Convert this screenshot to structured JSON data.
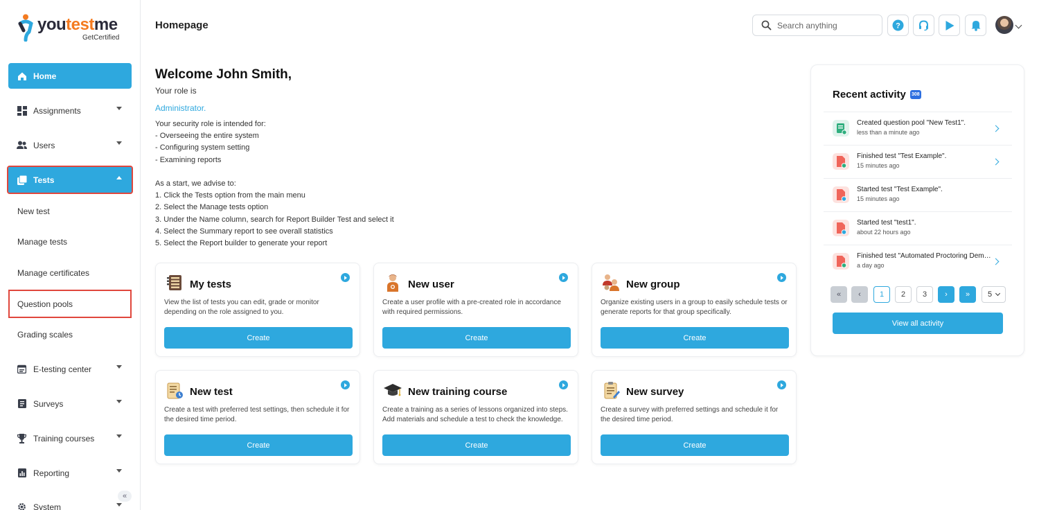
{
  "app": {
    "logo_text_1": "you",
    "logo_text_2": "test",
    "logo_text_3": "me",
    "logo_sub": "GetCertified"
  },
  "sidebar": {
    "items": [
      {
        "label": "Home",
        "icon": "home-icon"
      },
      {
        "label": "Assignments",
        "icon": "dashboard-icon"
      },
      {
        "label": "Users",
        "icon": "users-icon"
      },
      {
        "label": "Tests",
        "icon": "tests-icon"
      },
      {
        "label": "New test"
      },
      {
        "label": "Manage tests"
      },
      {
        "label": "Manage certificates"
      },
      {
        "label": "Question pools"
      },
      {
        "label": "Grading scales"
      },
      {
        "label": "E-testing center",
        "icon": "calendar-icon"
      },
      {
        "label": "Surveys",
        "icon": "survey-icon"
      },
      {
        "label": "Training courses",
        "icon": "trophy-icon"
      },
      {
        "label": "Reporting",
        "icon": "report-icon"
      },
      {
        "label": "System",
        "icon": "gear-icon"
      }
    ],
    "collapse_glyph": "«"
  },
  "header": {
    "title": "Homepage",
    "search_placeholder": "Search anything"
  },
  "welcome": {
    "greeting": "Welcome John Smith,",
    "role_label": "Your role is",
    "role_value": "Administrator.",
    "intro": "Your security role is intended for:\n- Overseeing the entire system\n- Configuring system setting\n- Examining reports\n\nAs a start, we advise to:\n1. Click the Tests option from the main menu\n2. Select the Manage tests option\n3. Under the Name column, search for Report Builder Test and select it\n4. Select the Summary report to see overall statistics\n5. Select the Report builder to generate your report"
  },
  "cards": [
    {
      "title": "My tests",
      "desc": "View the list of tests you can edit, grade or monitor depending on the role assigned to you.",
      "button": "Create",
      "icon": "list-icon"
    },
    {
      "title": "New user",
      "desc": "Create a user profile with a pre-created role in accordance with required permissions.",
      "button": "Create",
      "icon": "user-icon"
    },
    {
      "title": "New group",
      "desc": "Organize existing users in a group to easily schedule tests or generate reports for that group specifically.",
      "button": "Create",
      "icon": "group-icon"
    },
    {
      "title": "New test",
      "desc": "Create a test with preferred test settings, then schedule it for the desired time period.",
      "button": "Create",
      "icon": "test-icon"
    },
    {
      "title": "New training course",
      "desc": "Create a training as a series of lessons organized into steps. Add materials and schedule a test to check the knowledge.",
      "button": "Create",
      "icon": "graduation-icon"
    },
    {
      "title": "New survey",
      "desc": "Create a survey with preferred settings and schedule it for the desired time period.",
      "button": "Create",
      "icon": "survey-icon"
    }
  ],
  "activity": {
    "title": "Recent activity",
    "badge": "308",
    "rows": [
      {
        "text": "Created question pool \"New Test1\".",
        "time": "less than a minute ago",
        "arrow": true,
        "icon": "question-pool-icon"
      },
      {
        "text": "Finished test \"Test Example\".",
        "time": "15 minutes ago",
        "arrow": true,
        "icon": "test-finished-icon"
      },
      {
        "text": "Started test \"Test Example\".",
        "time": "15 minutes ago",
        "arrow": false,
        "icon": "test-started-icon"
      },
      {
        "text": "Started test \"test1\".",
        "time": "about 22 hours ago",
        "arrow": false,
        "icon": "test-started-icon"
      },
      {
        "text": "Finished test \"Automated Proctoring Demo\".",
        "time": "a day ago",
        "arrow": true,
        "icon": "test-finished-icon"
      }
    ],
    "pager": {
      "first": "«",
      "prev": "‹",
      "pages": [
        "1",
        "2",
        "3"
      ],
      "next": "›",
      "last": "»",
      "page_size": "5"
    },
    "view_all": "View all activity"
  },
  "colors": {
    "accent": "#2ea8de",
    "highlight": "#e0463c",
    "brand_orange": "#f47b20"
  }
}
